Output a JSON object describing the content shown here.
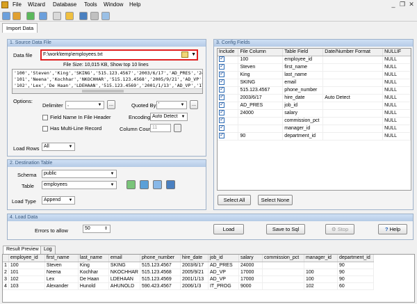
{
  "menu": [
    "File",
    "Wizard",
    "Database",
    "Tools",
    "Window",
    "Help"
  ],
  "tabs": {
    "main": "Import Data"
  },
  "source": {
    "title": "1. Source Data File",
    "data_file_label": "Data file",
    "data_file_value": "F:\\work\\temp\\employees.txt",
    "file_info": "File Size: 10,015 KB,  Show top 10 lines",
    "preview_lines": [
      "'100','Steven','King','SKING','515.123.4567','2003/6/17','AD_PRES','24000','','','90'",
      "'101','Neena','Kochhar','NKOCHHAR','515.123.4568','2005/9/21','AD_VP','17000','','100'",
      "'102','Lex','De Haan','LDEHAAN','515.123.4569','2001/1/13','AD_VP','17000','','100'"
    ],
    "options_label": "Options:",
    "delimiter_label": "Delimiter",
    "delimiter_value": ",",
    "quoted_by_label": "Quoted By",
    "quoted_by_value": "'",
    "field_name_header": "Field Name In File Header",
    "multiline_record": "Has Multi-Line Record",
    "encoding_label": "Encoding",
    "encoding_value": "Auto Detect",
    "column_count_label": "Column Count",
    "column_count_value": "11",
    "load_rows_label": "Load Rows",
    "load_rows_value": "All"
  },
  "destination": {
    "title": "2. Destination Table",
    "schema_label": "Schema",
    "schema_value": "public",
    "table_label": "Table",
    "table_value": "employees",
    "load_type_label": "Load Type",
    "load_type_value": "Append"
  },
  "config": {
    "title": "3. Config Fields",
    "columns": [
      "Include",
      "File Column",
      "Table Field",
      "Date/Number Format",
      "NULLIF"
    ],
    "rows": [
      [
        "100",
        "employee_id",
        "",
        "NULL"
      ],
      [
        "Steven",
        "first_name",
        "",
        "NULL"
      ],
      [
        "King",
        "last_name",
        "",
        "NULL"
      ],
      [
        "SKING",
        "email",
        "",
        "NULL"
      ],
      [
        "515.123.4567",
        "phone_number",
        "",
        "NULL"
      ],
      [
        "2003/6/17",
        "hire_date",
        "Auto Detect",
        "NULL"
      ],
      [
        "AD_PRES",
        "job_id",
        "",
        "NULL"
      ],
      [
        "24000",
        "salary",
        "",
        "NULL"
      ],
      [
        "",
        "commission_pct",
        "",
        "NULL"
      ],
      [
        "",
        "manager_id",
        "",
        "NULL"
      ],
      [
        "90",
        "department_id",
        "",
        "NULL"
      ]
    ],
    "select_all": "Select All",
    "select_none": "Select None"
  },
  "load": {
    "title": "4. Load Data",
    "errors_label": "Errors to allow",
    "errors_value": "50",
    "load_btn": "Load",
    "save_btn": "Save to Sql",
    "stop_btn": "Stop",
    "help_btn": "Help"
  },
  "result": {
    "tabs": [
      "Result Preview",
      "Log"
    ],
    "columns": [
      "employee_id",
      "first_name",
      "last_name",
      "email",
      "phone_number",
      "hire_date",
      "job_id",
      "salary",
      "commission_pct",
      "manager_id",
      "department_id"
    ],
    "rows": [
      [
        "1",
        "100",
        "Steven",
        "King",
        "SKING",
        "515.123.4567",
        "2003/6/17",
        "AD_PRES",
        "24000",
        "",
        "",
        "90"
      ],
      [
        "2",
        "101",
        "Neena",
        "Kochhar",
        "NKOCHHAR",
        "515.123.4568",
        "2005/9/21",
        "AD_VP",
        "17000",
        "",
        "100",
        "90"
      ],
      [
        "3",
        "102",
        "Lex",
        "De Haan",
        "LDEHAAN",
        "515.123.4569",
        "2001/1/13",
        "AD_VP",
        "17000",
        "",
        "100",
        "90"
      ],
      [
        "4",
        "103",
        "Alexander",
        "Hunold",
        "AHUNOLD",
        "590.423.4567",
        "2006/1/3",
        "IT_PROG",
        "9000",
        "",
        "102",
        "60"
      ]
    ]
  }
}
